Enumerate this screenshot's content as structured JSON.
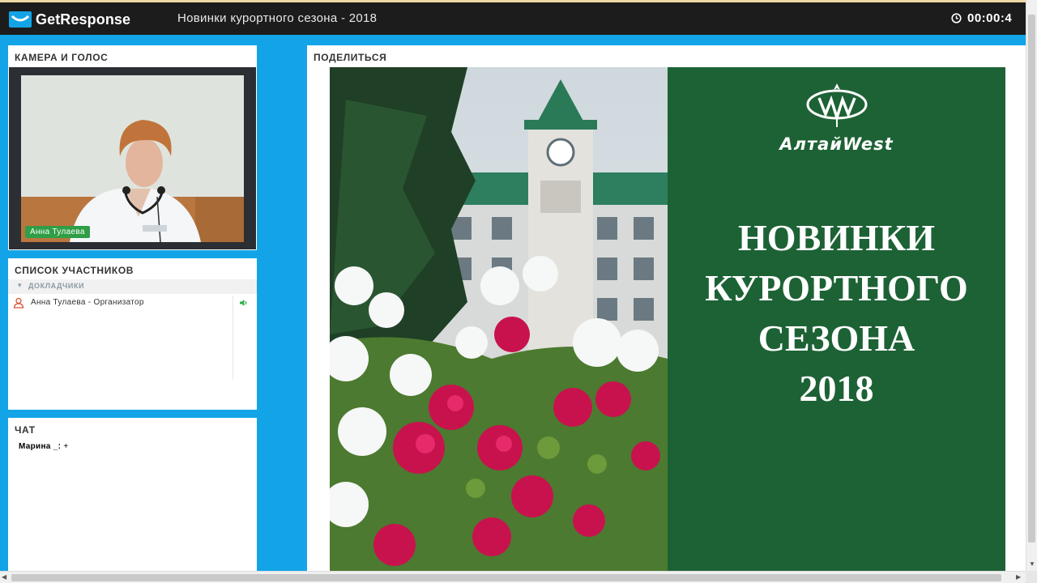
{
  "app": {
    "brand": "GetResponse",
    "webinar_title": "Новинки курортного сезона - 2018",
    "timer": "00:00:4"
  },
  "camera": {
    "title": "КАМЕРА И ГОЛОС",
    "speaker_name": "Анна Тулаева"
  },
  "participants": {
    "title": "СПИСОК УЧАСТНИКОВ",
    "section_label": "ДОКЛАДЧИКИ",
    "items": [
      {
        "name": "Анна Тулаева - Организатор"
      }
    ]
  },
  "chat": {
    "title": "ЧАТ",
    "messages": [
      {
        "author": "Марина _:",
        "text": "+"
      }
    ]
  },
  "share": {
    "title": "ПОДЕЛИТЬСЯ",
    "slide": {
      "brand": "АлтайWest",
      "title_lines": [
        "НОВИНКИ",
        "КУРОРТНОГО",
        "СЕЗОНА",
        "2018"
      ]
    }
  },
  "colors": {
    "background": "#12a4e6",
    "header": "#1c1c1c",
    "slide_green": "#1d6235",
    "name_badge": "#2f9e46"
  }
}
